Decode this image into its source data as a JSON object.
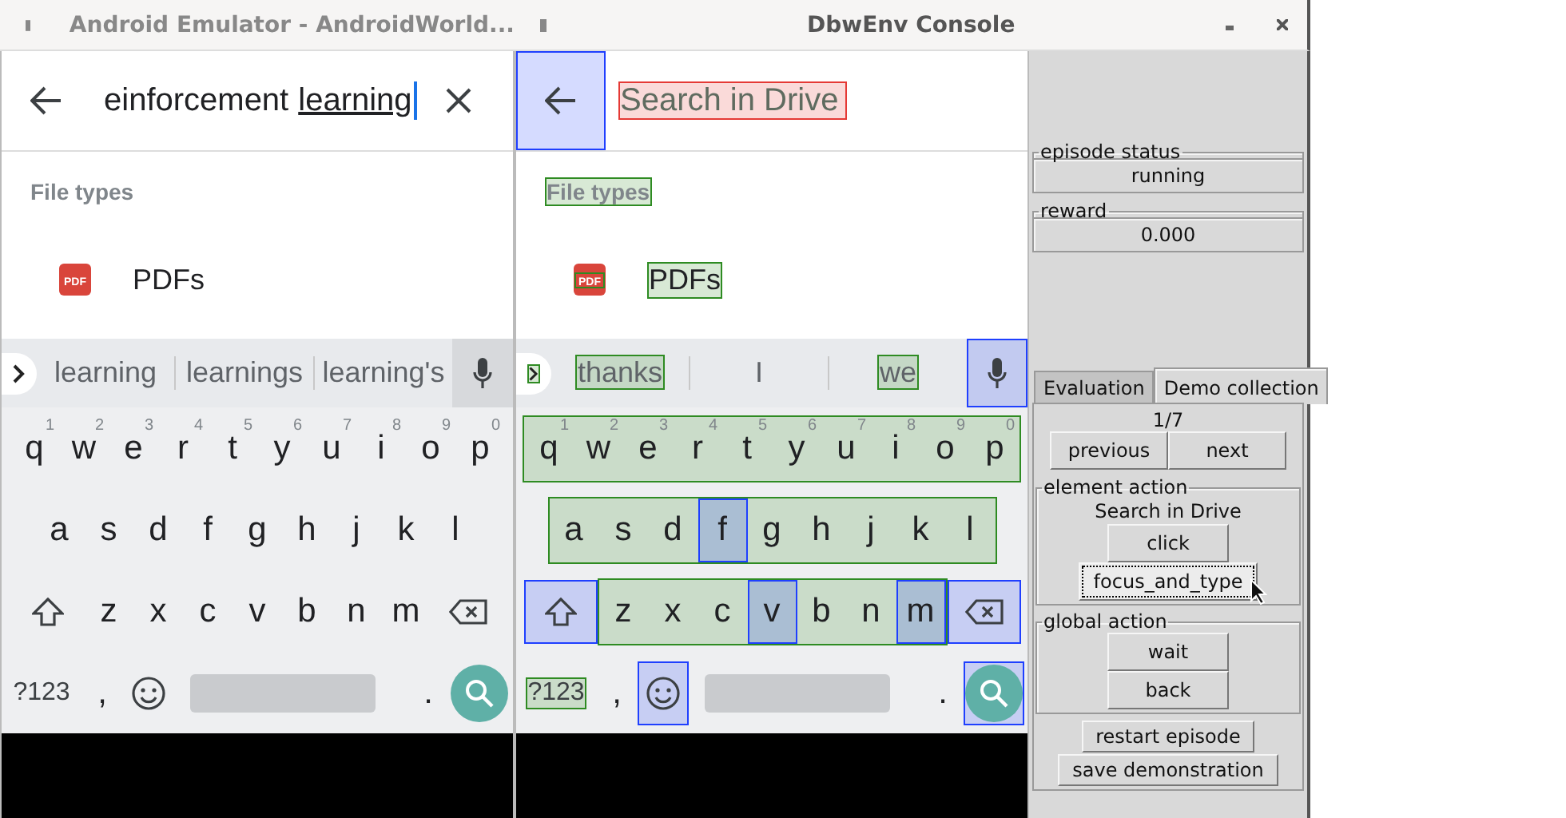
{
  "emulator": {
    "title": "Android Emulator - AndroidWorld...",
    "screen": {
      "search": {
        "value": "einforcement",
        "composing": "learning"
      },
      "section": {
        "label": "File types"
      },
      "items": [
        {
          "icon": {
            "label": "PDF"
          },
          "label": "PDFs"
        }
      ],
      "suggestions": {
        "words": [
          {
            "text": "learning"
          },
          {
            "text": "learnings"
          },
          {
            "text": "learning's"
          }
        ]
      },
      "keyboard": {
        "rows": [
          {
            "keys": [
              {
                "kind": "letter",
                "label": "q",
                "hint": "1"
              },
              {
                "kind": "letter",
                "label": "w",
                "hint": "2"
              },
              {
                "kind": "letter",
                "label": "e",
                "hint": "3"
              },
              {
                "kind": "letter",
                "label": "r",
                "hint": "4"
              },
              {
                "kind": "letter",
                "label": "t",
                "hint": "5"
              },
              {
                "kind": "letter",
                "label": "y",
                "hint": "6"
              },
              {
                "kind": "letter",
                "label": "u",
                "hint": "7"
              },
              {
                "kind": "letter",
                "label": "i",
                "hint": "8"
              },
              {
                "kind": "letter",
                "label": "o",
                "hint": "9"
              },
              {
                "kind": "letter",
                "label": "p",
                "hint": "0"
              }
            ]
          },
          {
            "keys": [
              {
                "kind": "letter",
                "label": "a"
              },
              {
                "kind": "letter",
                "label": "s"
              },
              {
                "kind": "letter",
                "label": "d"
              },
              {
                "kind": "letter",
                "label": "f"
              },
              {
                "kind": "letter",
                "label": "g"
              },
              {
                "kind": "letter",
                "label": "h"
              },
              {
                "kind": "letter",
                "label": "j"
              },
              {
                "kind": "letter",
                "label": "k"
              },
              {
                "kind": "letter",
                "label": "l"
              }
            ]
          },
          {
            "keys": [
              {
                "kind": "shift"
              },
              {
                "kind": "letter",
                "label": "z"
              },
              {
                "kind": "letter",
                "label": "x"
              },
              {
                "kind": "letter",
                "label": "c"
              },
              {
                "kind": "letter",
                "label": "v"
              },
              {
                "kind": "letter",
                "label": "b"
              },
              {
                "kind": "letter",
                "label": "n"
              },
              {
                "kind": "letter",
                "label": "m"
              },
              {
                "kind": "backspace"
              }
            ]
          },
          {
            "keys": [
              {
                "kind": "symbols",
                "label": "?123"
              },
              {
                "kind": "char",
                "label": ","
              },
              {
                "kind": "emoji"
              },
              {
                "kind": "space"
              },
              {
                "kind": "char",
                "label": "."
              },
              {
                "kind": "search"
              }
            ]
          }
        ]
      }
    }
  },
  "console": {
    "title": "DbwEnv Console",
    "screen": {
      "back_button": {
        "color": "#1f3fff"
      },
      "search": {
        "placeholder": "Search in Drive",
        "color": "#e53935"
      },
      "section": {
        "label": "File types",
        "color": "#2e8b22"
      },
      "items": [
        {
          "icon": {
            "label": "PDF",
            "color": "#2e8b22"
          },
          "label": "PDFs",
          "color": "#2e8b22"
        }
      ],
      "suggestions": {
        "expand_button": {
          "color": "#2e8b22"
        },
        "mic_button": {
          "color": "#1f3fff"
        },
        "words": [
          {
            "text": "thanks",
            "color": "#2e8b22"
          },
          {
            "text": "I"
          },
          {
            "text": "we",
            "color": "#2e8b22"
          }
        ]
      },
      "keyboard": {
        "rows": [
          {
            "color": "#2e8b22",
            "keys": [
              {
                "kind": "letter",
                "label": "q",
                "hint": "1"
              },
              {
                "kind": "letter",
                "label": "w",
                "hint": "2"
              },
              {
                "kind": "letter",
                "label": "e",
                "hint": "3"
              },
              {
                "kind": "letter",
                "label": "r",
                "hint": "4"
              },
              {
                "kind": "letter",
                "label": "t",
                "hint": "5"
              },
              {
                "kind": "letter",
                "label": "y",
                "hint": "6"
              },
              {
                "kind": "letter",
                "label": "u",
                "hint": "7"
              },
              {
                "kind": "letter",
                "label": "i",
                "hint": "8"
              },
              {
                "kind": "letter",
                "label": "o",
                "hint": "9"
              },
              {
                "kind": "letter",
                "label": "p",
                "hint": "0"
              }
            ]
          },
          {
            "color": "#2e8b22",
            "keys": [
              {
                "kind": "letter",
                "label": "a"
              },
              {
                "kind": "letter",
                "label": "s"
              },
              {
                "kind": "letter",
                "label": "d"
              },
              {
                "kind": "letter",
                "label": "f",
                "color": "#1f3fff"
              },
              {
                "kind": "letter",
                "label": "g"
              },
              {
                "kind": "letter",
                "label": "h"
              },
              {
                "kind": "letter",
                "label": "j"
              },
              {
                "kind": "letter",
                "label": "k"
              },
              {
                "kind": "letter",
                "label": "l"
              }
            ]
          },
          {
            "color": "#2e8b22",
            "keys": [
              {
                "kind": "shift",
                "color": "#1f3fff"
              },
              {
                "kind": "letter",
                "label": "z"
              },
              {
                "kind": "letter",
                "label": "x"
              },
              {
                "kind": "letter",
                "label": "c"
              },
              {
                "kind": "letter",
                "label": "v",
                "color": "#1f3fff"
              },
              {
                "kind": "letter",
                "label": "b"
              },
              {
                "kind": "letter",
                "label": "n"
              },
              {
                "kind": "letter",
                "label": "m",
                "color": "#1f3fff"
              },
              {
                "kind": "backspace",
                "color": "#1f3fff"
              }
            ]
          },
          {
            "keys": [
              {
                "kind": "symbols",
                "label": "?123",
                "color": "#2e8b22"
              },
              {
                "kind": "char",
                "label": ","
              },
              {
                "kind": "emoji",
                "color": "#1f3fff"
              },
              {
                "kind": "space"
              },
              {
                "kind": "char",
                "label": "."
              },
              {
                "kind": "search",
                "color": "#1f3fff"
              }
            ]
          }
        ]
      }
    },
    "panel": {
      "episode_status": {
        "label": "episode status",
        "value": "running"
      },
      "reward": {
        "label": "reward",
        "value": "0.000"
      },
      "tabs": [
        {
          "label": "Evaluation",
          "selected": false
        },
        {
          "label": "Demo collection",
          "selected": true
        }
      ],
      "progress": "1/7",
      "nav_buttons": [
        "previous",
        "next"
      ],
      "element_action": {
        "label": "element action",
        "target": "Search in Drive",
        "buttons": [
          {
            "label": "click",
            "focused": false
          },
          {
            "label": "focus_and_type",
            "focused": true
          }
        ]
      },
      "global_action": {
        "label": "global action",
        "buttons": [
          "wait",
          "back"
        ]
      },
      "buttons": [
        "restart episode",
        "save demonstration"
      ]
    }
  }
}
